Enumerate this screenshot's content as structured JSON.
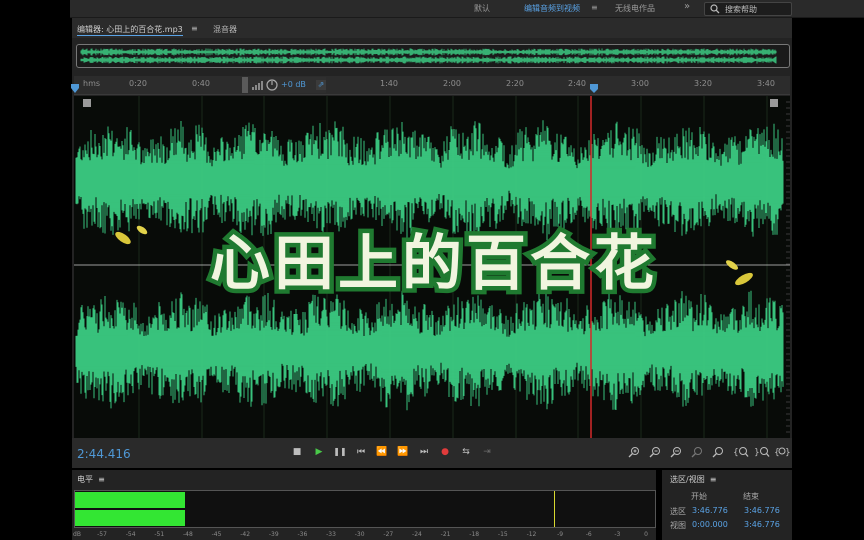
{
  "workspace_bar": {
    "items": [
      "默认",
      "编辑音频到视频",
      "无线电作品"
    ],
    "active_index": 1,
    "menu_icon": "≡",
    "more_icon": "»",
    "search_placeholder": "搜索帮助"
  },
  "editor": {
    "tabs": [
      {
        "label": "编辑器: 心田上的百合花.mp3",
        "menu": "≡"
      },
      {
        "label": "混音器",
        "menu": ""
      }
    ],
    "ruler": {
      "unit": "hms",
      "ticks": [
        "0:20",
        "0:40",
        "1:40",
        "2:00",
        "2:20",
        "2:40",
        "3:00",
        "3:20",
        "3:40"
      ],
      "volume_label": "+0 dB"
    },
    "overlay_title": "心田上的百合花"
  },
  "transport": {
    "timecode": "2:44.416",
    "buttons": [
      {
        "name": "stop-button",
        "glyph": "■"
      },
      {
        "name": "play-button",
        "glyph": "▶"
      },
      {
        "name": "pause-button",
        "glyph": "❚❚"
      },
      {
        "name": "skip-start-button",
        "glyph": "⏮"
      },
      {
        "name": "rewind-button",
        "glyph": "⏪"
      },
      {
        "name": "fast-forward-button",
        "glyph": "⏩"
      },
      {
        "name": "skip-end-button",
        "glyph": "⏭"
      },
      {
        "name": "record-button",
        "glyph": "●"
      },
      {
        "name": "loop-button",
        "glyph": "⇆"
      },
      {
        "name": "skip-selection-button",
        "glyph": "⇥"
      }
    ],
    "zoom_buttons": [
      "zoom-in-amplitude",
      "zoom-out-amplitude",
      "zoom-in-time",
      "zoom-out-time",
      "zoom-full",
      "zoom-in-left",
      "zoom-in-right",
      "zoom-selection"
    ],
    "colors": {
      "play": "#49c949",
      "record": "#e03b3b",
      "timecode": "#4f98d6"
    }
  },
  "levels": {
    "header": "电平",
    "menu": "≡",
    "scale": [
      "dB",
      "-57",
      "-54",
      "-51",
      "-48",
      "-45",
      "-42",
      "-39",
      "-36",
      "-33",
      "-30",
      "-27",
      "-24",
      "-21",
      "-18",
      "-15",
      "-12",
      "-9",
      "-6",
      "-3",
      "0"
    ],
    "level_fraction": 0.19,
    "peak_fraction": 0.825,
    "meter_color": "#33e633"
  },
  "selection_view": {
    "header": "选区/视图",
    "menu": "≡",
    "columns": [
      "开始",
      "结束"
    ],
    "rows": [
      {
        "label": "选区",
        "start": "3:46.776",
        "end": "3:46.776"
      },
      {
        "label": "视图",
        "start": "0:00.000",
        "end": "3:46.776"
      }
    ]
  },
  "waveform_color": "#3fd68a",
  "playhead_color": "#d42a2a"
}
